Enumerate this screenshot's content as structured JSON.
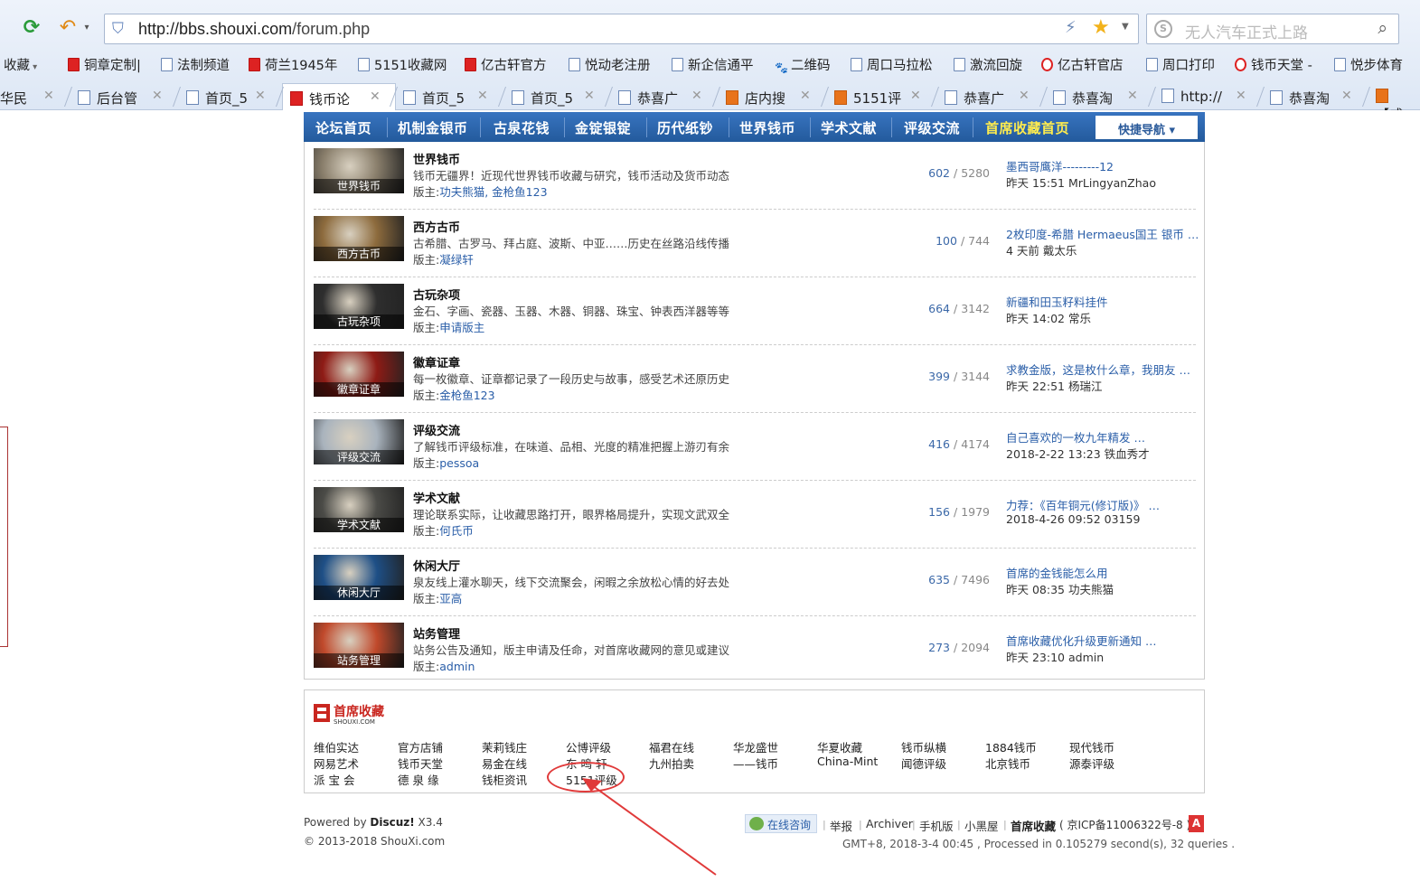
{
  "browser": {
    "url_host": "http://bbs.shouxi.com",
    "url_path": "/forum.php",
    "search_placeholder": "无人汽车正式上路",
    "search_engine_letter": "S",
    "bookmarks": [
      {
        "label": "收藏",
        "icon": "folder-icon"
      },
      {
        "label": "铜章定制|",
        "icon": "red-page-icon"
      },
      {
        "label": "法制频道",
        "icon": "page-icon"
      },
      {
        "label": "荷兰1945年",
        "icon": "red-page-icon"
      },
      {
        "label": "5151收藏网",
        "icon": "page-icon"
      },
      {
        "label": "亿古轩官方",
        "icon": "red-page-icon"
      },
      {
        "label": "悦动老注册",
        "icon": "page-icon"
      },
      {
        "label": "新企信通平",
        "icon": "page-icon"
      },
      {
        "label": "二维码",
        "icon": "paw-icon"
      },
      {
        "label": "周口马拉松",
        "icon": "page-icon"
      },
      {
        "label": "激流回旋",
        "icon": "page-icon"
      },
      {
        "label": "亿古轩官店",
        "icon": "ring-icon"
      },
      {
        "label": "周口打印",
        "icon": "page-icon"
      },
      {
        "label": "钱币天堂 -",
        "icon": "ring-icon"
      },
      {
        "label": "悦步体育",
        "icon": "page-icon"
      }
    ],
    "tabs": [
      {
        "label": "华民",
        "icon": "page-icon"
      },
      {
        "label": "后台管",
        "icon": "page-icon"
      },
      {
        "label": "首页_5",
        "icon": "page-icon"
      },
      {
        "label": "钱币论",
        "icon": "red-page-icon",
        "active": true
      },
      {
        "label": "首页_5",
        "icon": "page-icon"
      },
      {
        "label": "首页_5",
        "icon": "page-icon"
      },
      {
        "label": "恭喜广",
        "icon": "page-icon"
      },
      {
        "label": "店内搜",
        "icon": "taobao-icon"
      },
      {
        "label": "5151评",
        "icon": "taobao-icon"
      },
      {
        "label": "恭喜广",
        "icon": "page-icon"
      },
      {
        "label": "恭喜淘",
        "icon": "page-icon"
      },
      {
        "label": "http://",
        "icon": "page-icon"
      },
      {
        "label": "恭喜淘",
        "icon": "page-icon"
      },
      {
        "label": "【咸",
        "icon": "taobao-icon"
      }
    ]
  },
  "nav": {
    "items": [
      "论坛首页",
      "机制金银币",
      "古泉花钱",
      "金锭银锭",
      "历代纸钞",
      "世界钱币",
      "学术文献",
      "评级交流",
      "首席收藏首页"
    ],
    "quick_nav": "快捷导航 ▾"
  },
  "boards": [
    {
      "name": "世界钱币",
      "desc": "钱币无疆界！近现代世界钱币收藏与研究，钱币活动及货币动态",
      "mod_label": "版主:",
      "mods": "功夫熊猫, 金枪鱼123",
      "threads": "602",
      "posts": "5280",
      "last_title": "墨西哥鹰洋---------12",
      "last_meta": "昨天 15:51 MrLingyanZhao",
      "thumb_color": "#8a7f6c"
    },
    {
      "name": "西方古币",
      "desc": "古希腊、古罗马、拜占庭、波斯、中亚……历史在丝路沿线传播",
      "mod_label": "版主:",
      "mods": "凝绿轩",
      "threads": "100",
      "posts": "744",
      "last_title": "2枚印度-希腊 Hermaeus国王 银币 …",
      "last_meta": "4 天前 戴太乐",
      "thumb_color": "#8d6b3d"
    },
    {
      "name": "古玩杂项",
      "desc": "金石、字画、瓷器、玉器、木器、铜器、珠宝、钟表西洋器等等",
      "mod_label": "版主:",
      "mods": "申请版主",
      "threads": "664",
      "posts": "3142",
      "last_title": "新疆和田玉籽料挂件",
      "last_meta": "昨天 14:02 常乐",
      "thumb_color": "#2e2e2e"
    },
    {
      "name": "徽章证章",
      "desc": "每一枚徽章、证章都记录了一段历史与故事，感受艺术还原历史",
      "mod_label": "版主:",
      "mods": "金枪鱼123",
      "threads": "399",
      "posts": "3144",
      "last_title": "求教金版，这是枚什么章，我朋友 …",
      "last_meta": "昨天 22:51 杨瑞江",
      "thumb_color": "#8e1b15"
    },
    {
      "name": "评级交流",
      "desc": "了解钱币评级标准，在味道、品相、光度的精准把握上游刃有余",
      "mod_label": "版主:",
      "mods": "pessoa",
      "threads": "416",
      "posts": "4174",
      "last_title": "自己喜欢的一枚九年精发 …",
      "last_meta": "2018-2-22 13:23 铁血秀才",
      "thumb_color": "#a9b3bd"
    },
    {
      "name": "学术文献",
      "desc": "理论联系实际，让收藏思路打开，眼界格局提升，实现文武双全",
      "mod_label": "版主:",
      "mods": "何氏币",
      "threads": "156",
      "posts": "1979",
      "last_title": "力荐：《百年铜元(修订版)》 …",
      "last_meta": "2018-4-26 09:52 03159",
      "thumb_color": "#4b4b47"
    },
    {
      "name": "休闲大厅",
      "desc": "泉友线上灌水聊天，线下交流聚会，闲暇之余放松心情的好去处",
      "mod_label": "版主:",
      "mods": "亚高",
      "threads": "635",
      "posts": "7496",
      "last_title": "首席的金钱能怎么用",
      "last_meta": "昨天 08:35 功夫熊猫",
      "thumb_color": "#1e4f86"
    },
    {
      "name": "站务管理",
      "desc": "站务公告及通知，版主申请及任命，对首席收藏网的意见或建议",
      "mod_label": "版主:",
      "mods": "admin",
      "threads": "273",
      "posts": "2094",
      "last_title": "首席收藏优化升级更新通知 …",
      "last_meta": "昨天 23:10 admin",
      "thumb_color": "#c0492b"
    }
  ],
  "links": {
    "logo_text": "首席收藏",
    "logo_sub": "SHOUXI.COM",
    "columns": [
      [
        "维伯实达",
        "网易艺术",
        "派 宝 会"
      ],
      [
        "官方店铺",
        "钱币天堂",
        "德 泉 缘"
      ],
      [
        "茉莉钱庄",
        "易金在线",
        "钱柜资讯"
      ],
      [
        "公博评级",
        "东 鸣 轩",
        "5151评级"
      ],
      [
        "福君在线",
        "九州拍卖"
      ],
      [
        "华龙盛世",
        "——钱币"
      ],
      [
        "华夏收藏",
        "China-Mint"
      ],
      [
        "钱币纵横",
        "闻德评级"
      ],
      [
        "1884钱币",
        "北京钱币"
      ],
      [
        "现代钱币",
        "源泰评级"
      ]
    ]
  },
  "footer": {
    "powered_prefix": "Powered by ",
    "powered_name": "Discuz!",
    "powered_ver": " X3.4",
    "copyright": "© 2013-2018 ShouXi.com",
    "online_consult": "在线咨询",
    "links": [
      "举报",
      "Archiver",
      "手机版",
      "小黑屋"
    ],
    "site_name": "首席收藏",
    "icp": "( 京ICP备11006322号-8 )",
    "icp_icon": "A",
    "stats": "GMT+8, 2018-3-4 00:45 , Processed in 0.105279 second(s), 32 queries ."
  }
}
